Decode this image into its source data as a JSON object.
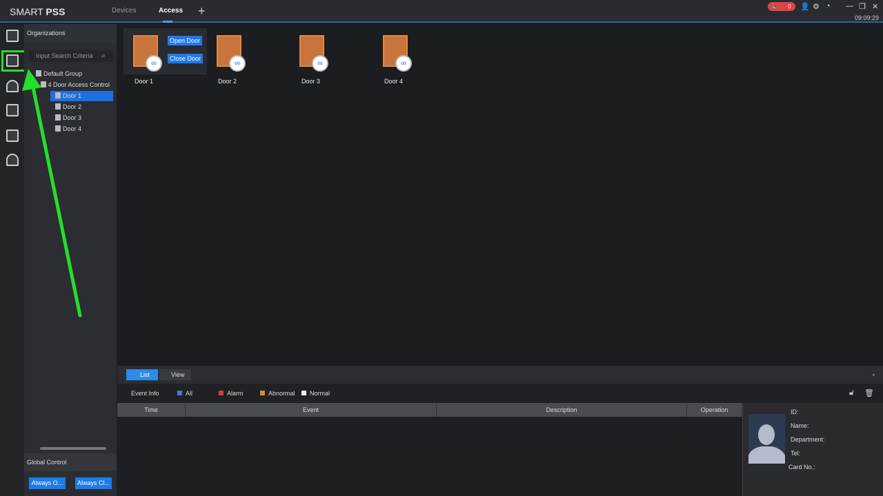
{
  "app": {
    "logo_light": "SMART ",
    "logo_bold": "PSS",
    "tabs": [
      {
        "label": "Devices"
      },
      {
        "label": "Access"
      }
    ],
    "add_tab": "+",
    "alarm_count": "0",
    "clock": "09:09:29"
  },
  "org": {
    "title": "Organizations",
    "search_placeholder": "Input Search Criteria",
    "tree": {
      "group": "Default Group",
      "device": "4 Door Access Control",
      "doors": [
        "Door 1",
        "Door 2",
        "Door 3",
        "Door 4"
      ]
    }
  },
  "global": {
    "title": "Global Control",
    "always_open": "Always O...",
    "always_close": "Always Cl..."
  },
  "doors": [
    {
      "label": "Door 1"
    },
    {
      "label": "Door 2"
    },
    {
      "label": "Door 3"
    },
    {
      "label": "Door 4"
    }
  ],
  "door_actions": {
    "open": "Open Door",
    "close": "Close Door"
  },
  "bottom": {
    "list": "List",
    "view": "View",
    "event_info": "Event Info",
    "filters": [
      {
        "label": "All",
        "color": "#4a73d8"
      },
      {
        "label": "Alarm",
        "color": "#d83a3a"
      },
      {
        "label": "Abnormal",
        "color": "#e08a2a"
      },
      {
        "label": "Normal",
        "color": "#eeeeee"
      }
    ],
    "columns": [
      "Time",
      "Event",
      "Description",
      "Operation"
    ],
    "detail": {
      "id": "ID:",
      "name": "Name:",
      "department": "Department:",
      "tel": "Tel:",
      "card": "Card No.:"
    }
  },
  "colors": {
    "accent": "#1e7be8",
    "highlight": "#22e02a"
  }
}
